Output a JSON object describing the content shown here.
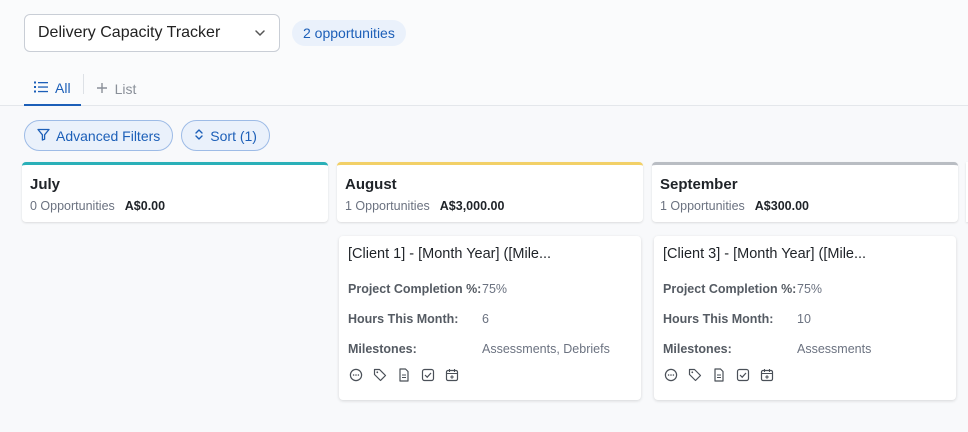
{
  "header": {
    "pipeline_name": "Delivery Capacity Tracker",
    "opportunity_count": "2 opportunities"
  },
  "tabs": [
    {
      "label": "All",
      "active": true
    },
    {
      "label": "List",
      "active": false
    }
  ],
  "filters": {
    "advanced_label": "Advanced Filters",
    "sort_label": "Sort (1)"
  },
  "columns": [
    {
      "title": "July",
      "count": "0 Opportunities",
      "amount": "A$0.00",
      "accent": "#2ab0b8"
    },
    {
      "title": "August",
      "count": "1 Opportunities",
      "amount": "A$3,000.00",
      "accent": "#f2d067",
      "card": {
        "title": "[Client 1] - [Month Year] ([Mile...",
        "fields": [
          {
            "label": "Project Completion %:",
            "value": "75%"
          },
          {
            "label": "Hours This Month:",
            "value": "6"
          },
          {
            "label": "Milestones:",
            "value": "Assessments, Debriefs"
          }
        ]
      }
    },
    {
      "title": "September",
      "count": "1 Opportunities",
      "amount": "A$300.00",
      "accent": "#b9bdc3",
      "card": {
        "title": "[Client 3] - [Month Year] ([Mile...",
        "fields": [
          {
            "label": "Project Completion %:",
            "value": "75%"
          },
          {
            "label": "Hours This Month:",
            "value": "10"
          },
          {
            "label": "Milestones:",
            "value": "Assessments"
          }
        ]
      }
    }
  ],
  "card_icons": [
    "comment-icon",
    "tag-icon",
    "document-icon",
    "task-check-icon",
    "calendar-add-icon"
  ]
}
